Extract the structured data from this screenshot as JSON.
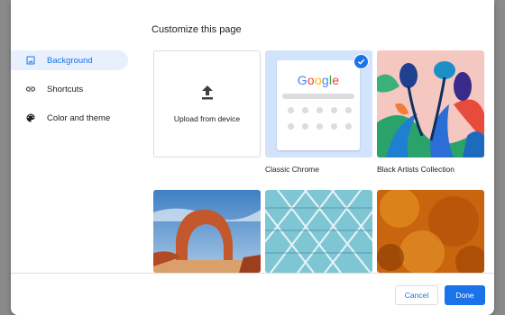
{
  "dialog": {
    "title": "Customize this page"
  },
  "sidebar": {
    "items": [
      {
        "label": "Background",
        "icon": "image-icon",
        "active": true
      },
      {
        "label": "Shortcuts",
        "icon": "link-icon",
        "active": false
      },
      {
        "label": "Color and theme",
        "icon": "palette-icon",
        "active": false
      }
    ]
  },
  "tiles": {
    "upload_label": "Upload from device",
    "classic_chrome": {
      "caption": "Classic Chrome",
      "logo_letters": [
        "G",
        "o",
        "o",
        "g",
        "l",
        "e"
      ],
      "logo_colors": [
        "#4285f4",
        "#ea4335",
        "#fbbc05",
        "#4285f4",
        "#34a853",
        "#ea4335"
      ],
      "selected": true
    },
    "black_artists": {
      "caption": "Black Artists Collection"
    }
  },
  "footer": {
    "cancel_label": "Cancel",
    "done_label": "Done"
  },
  "colors": {
    "accent": "#1a73e8",
    "selected_bg": "#e8f0fe",
    "tile_selected_bg": "#d2e3fc"
  }
}
